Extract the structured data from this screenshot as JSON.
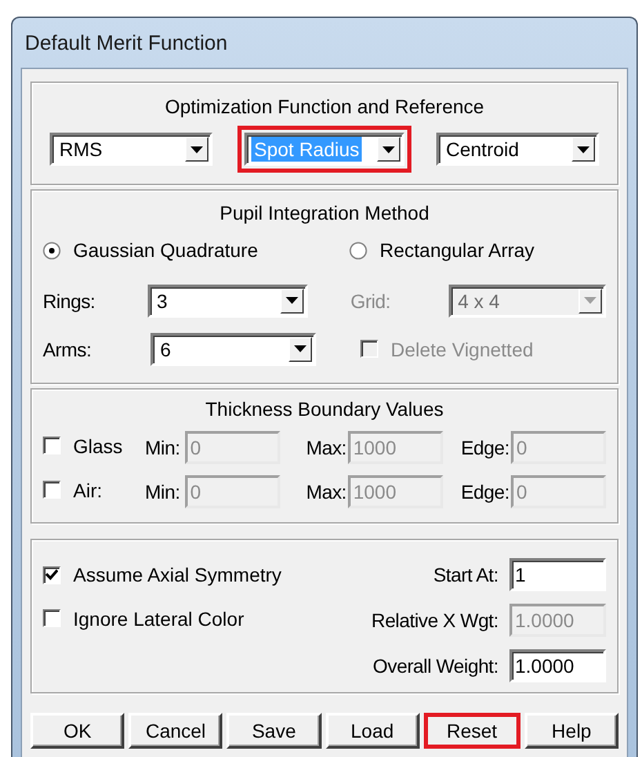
{
  "window": {
    "title": "Default Merit Function"
  },
  "optimization": {
    "title": "Optimization Function and Reference",
    "dropdowns": [
      {
        "value": "RMS",
        "focused": false,
        "highlighted": false
      },
      {
        "value": "Spot Radius",
        "focused": true,
        "highlighted": true
      },
      {
        "value": "Centroid",
        "focused": false,
        "highlighted": false
      }
    ]
  },
  "pupil": {
    "title": "Pupil Integration Method",
    "methods": [
      {
        "label": "Gaussian Quadrature",
        "selected": true
      },
      {
        "label": "Rectangular Array",
        "selected": false
      }
    ],
    "rings": {
      "label": "Rings:",
      "value": "3",
      "disabled": false
    },
    "arms": {
      "label": "Arms:",
      "value": "6",
      "disabled": false
    },
    "grid": {
      "label": "Grid:",
      "value": "4 x 4",
      "disabled": true
    },
    "delete_vignetted": {
      "label": "Delete Vignetted",
      "checked": false,
      "disabled": true
    }
  },
  "thickness": {
    "title": "Thickness Boundary Values",
    "rows": [
      {
        "label": "Glass",
        "checked": false,
        "min_label": "Min:",
        "min": "0",
        "max_label": "Max:",
        "max": "1000",
        "edge_label": "Edge:",
        "edge": "0",
        "disabled": true
      },
      {
        "label": "Air:",
        "checked": false,
        "min_label": "Min:",
        "min": "0",
        "max_label": "Max:",
        "max": "1000",
        "edge_label": "Edge:",
        "edge": "0",
        "disabled": true
      }
    ]
  },
  "options": {
    "checkboxes": [
      {
        "label": "Assume Axial Symmetry",
        "checked": true
      },
      {
        "label": "Ignore Lateral Color",
        "checked": false
      }
    ],
    "fields": [
      {
        "label": "Start At:",
        "value": "1",
        "disabled": false
      },
      {
        "label": "Relative X Wgt:",
        "value": "1.0000",
        "disabled": true
      },
      {
        "label": "Overall Weight:",
        "value": "1.0000",
        "disabled": false
      }
    ]
  },
  "buttons": [
    {
      "label": "OK",
      "highlighted": false
    },
    {
      "label": "Cancel",
      "highlighted": false
    },
    {
      "label": "Save",
      "highlighted": false
    },
    {
      "label": "Load",
      "highlighted": false
    },
    {
      "label": "Reset",
      "highlighted": true
    },
    {
      "label": "Help",
      "highlighted": false
    }
  ]
}
